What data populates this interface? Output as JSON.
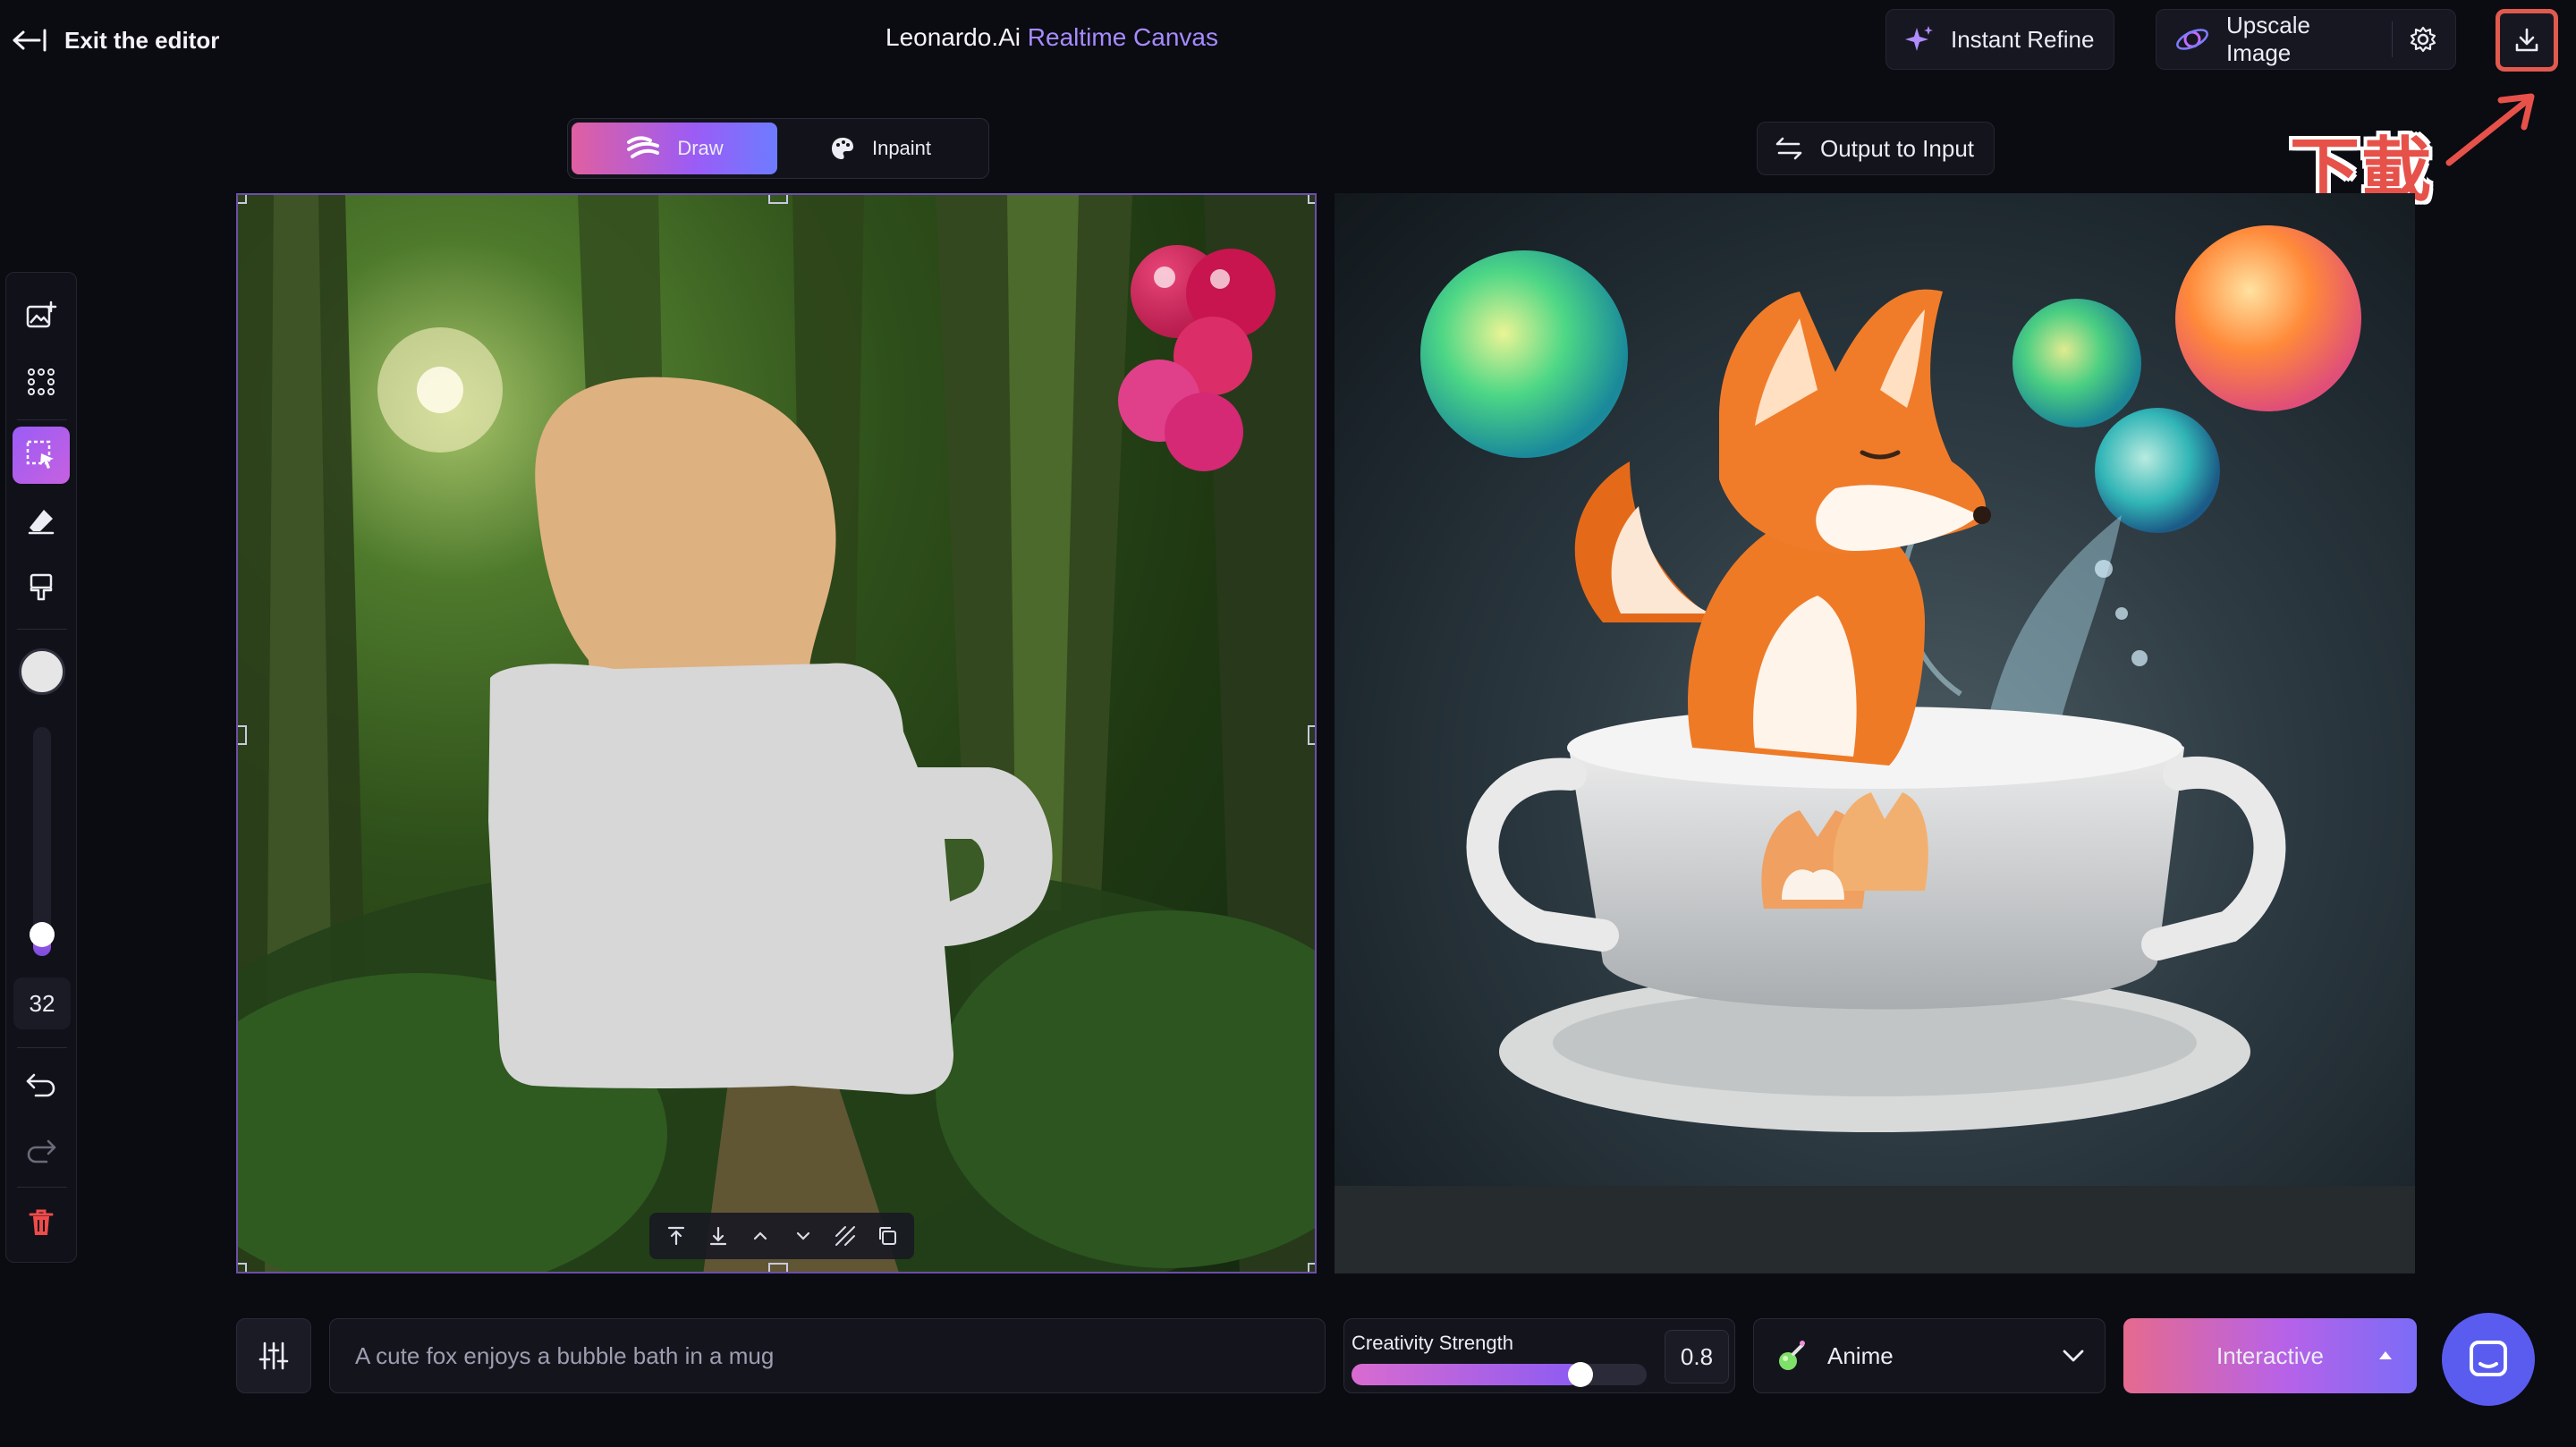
{
  "header": {
    "exit_label": "Exit the editor",
    "title_main": "Leonardo.Ai",
    "title_accent": "Realtime Canvas",
    "instant_refine_label": "Instant Refine",
    "upscale_label": "Upscale Image",
    "annotation_text": "下載"
  },
  "mode_toggle": {
    "draw_label": "Draw",
    "inpaint_label": "Inpaint",
    "active": "Draw"
  },
  "output_to_input_label": "Output to Input",
  "toolbar": {
    "brush_size": "32",
    "brush_slider_fraction": 0.15,
    "brush_color": "#e6e6e6"
  },
  "prompt": {
    "placeholder": "A cute fox enjoys a bubble bath in a mug"
  },
  "creativity": {
    "label": "Creativity Strength",
    "value": "0.8",
    "fraction": 0.8
  },
  "style": {
    "label": "Anime"
  },
  "generate": {
    "label": "Interactive"
  },
  "colors": {
    "accent": "#a68bff",
    "highlight": "#e05a4e",
    "chat": "#5a5cf0"
  }
}
